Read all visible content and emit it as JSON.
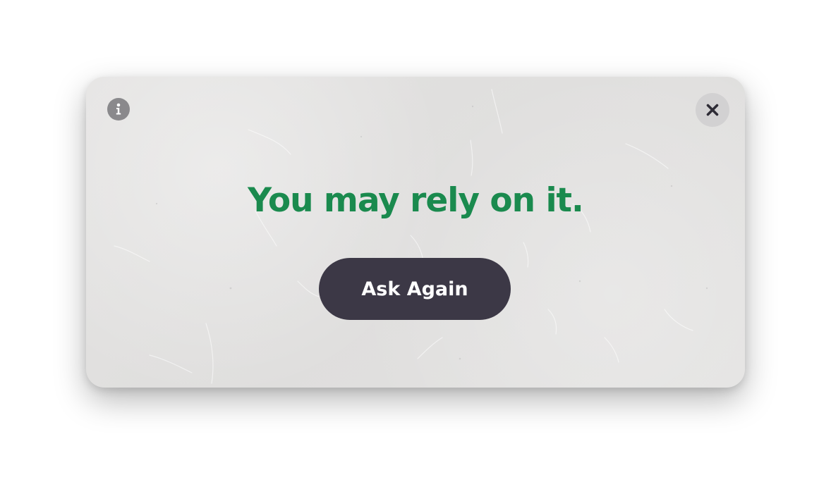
{
  "dialog": {
    "answer_text": "You may rely on it.",
    "ask_again_label": "Ask Again",
    "info_icon": "info-icon",
    "close_icon": "close-icon"
  },
  "colors": {
    "answer": "#1a8a4e",
    "button_bg": "#3c3846",
    "button_text": "#ffffff",
    "card_bg": "#e2e1e0"
  }
}
